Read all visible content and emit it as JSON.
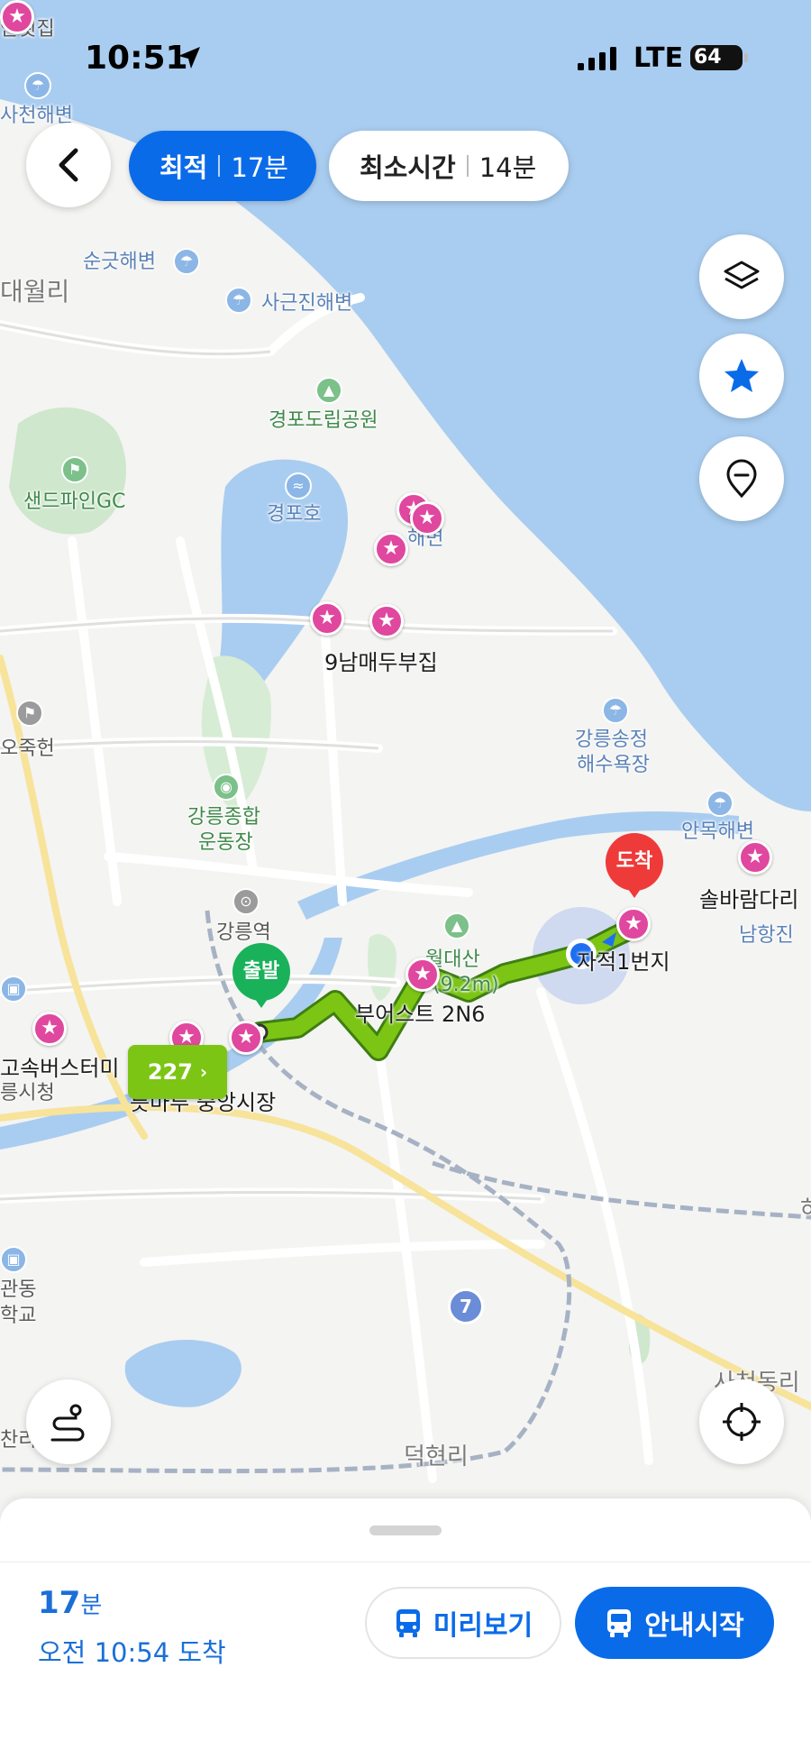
{
  "status_bar": {
    "time": "10:51",
    "network": "LTE",
    "battery": "64"
  },
  "route_options": [
    {
      "name": "최적",
      "time": "17분",
      "selected": true
    },
    {
      "name": "최소시간",
      "time": "14분",
      "selected": false
    }
  ],
  "map": {
    "labels": {
      "l1": "안횟집",
      "l2": "사천해변",
      "l3": "순긋해변",
      "l4": "대월리",
      "l5": "사근진해변",
      "l6": "경포도립공원",
      "l7": "샌드파인GC",
      "l8": "경포호",
      "l9": "해변",
      "l10": "9남매두부집",
      "l11": "오죽헌",
      "l12": "강릉송정",
      "l13": "해수욕장",
      "l14": "강릉종합",
      "l15": "운동장",
      "l16": "안목해변",
      "l17": "솔바람다리",
      "l18": "남항진",
      "l19": "강릉역",
      "l20": "월대산",
      "l21": "(9.2m)",
      "l22": "부어스트 2N6",
      "l23": "자적1번지",
      "l24": "고속버스터미",
      "l25": "릉시청",
      "l26": "릇마루 중앙시장",
      "l27": "관동",
      "l28": "학교",
      "l29": "찬리",
      "l30": "덕현리",
      "l31": "사천동리",
      "l32": "하"
    },
    "start_marker": "출발",
    "end_marker": "도착",
    "bus_route": "227",
    "road_number": "7"
  },
  "map_controls": [
    "layers-button",
    "favorites-button",
    "my-places-button",
    "route-overview-button",
    "current-location-button"
  ],
  "summary": {
    "duration_number": "17",
    "duration_unit": "분",
    "arrival": "오전 10:54 도착",
    "preview_label": "미리보기",
    "start_label": "안내시작"
  },
  "colors": {
    "accent": "#0a6be9",
    "route": "#7cc514",
    "start": "#19b15a",
    "end": "#ef3a3a",
    "poi": "#e0479e",
    "sea": "#a9cdf0"
  }
}
